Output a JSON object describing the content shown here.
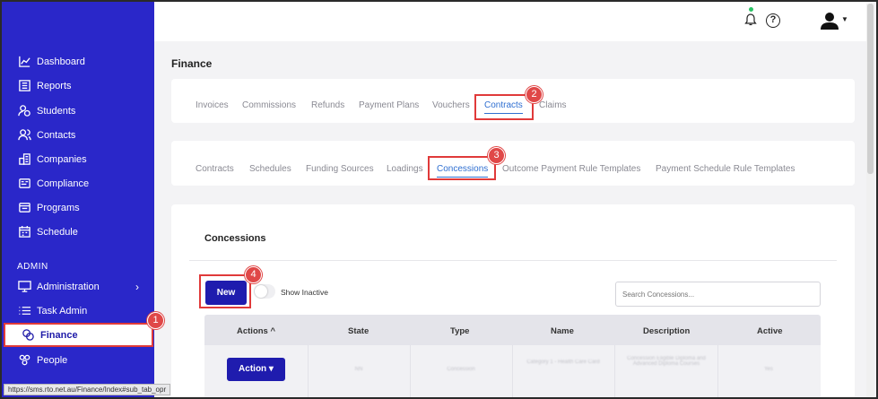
{
  "status_url": "https://sms.rto.net.au/Finance/Index#sub_tab_opr",
  "sidebar": {
    "items": [
      {
        "label": "Dashboard",
        "icon": "chart-line-icon"
      },
      {
        "label": "Reports",
        "icon": "report-icon"
      },
      {
        "label": "Students",
        "icon": "students-icon"
      },
      {
        "label": "Contacts",
        "icon": "contacts-icon"
      },
      {
        "label": "Companies",
        "icon": "companies-icon"
      },
      {
        "label": "Compliance",
        "icon": "compliance-icon"
      },
      {
        "label": "Programs",
        "icon": "programs-icon"
      },
      {
        "label": "Schedule",
        "icon": "calendar-icon"
      }
    ],
    "section_label": "ADMIN",
    "admin_items": [
      {
        "label": "Administration",
        "icon": "monitor-icon",
        "chevron": "›"
      },
      {
        "label": "Task Admin",
        "icon": "list-icon"
      },
      {
        "label": "Finance",
        "icon": "finance-icon",
        "active": true,
        "badge": "1"
      },
      {
        "label": "People",
        "icon": "people-icon"
      }
    ]
  },
  "header": {
    "help_label": "?"
  },
  "page": {
    "title": "Finance",
    "main_tabs": [
      "Invoices",
      "Commissions",
      "Refunds",
      "Payment Plans",
      "Vouchers",
      "Contracts",
      "Claims"
    ],
    "main_tab_badge": "2",
    "sub_tabs": [
      "Contracts",
      "Schedules",
      "Funding Sources",
      "Loadings",
      "Concessions",
      "Outcome Payment Rule Templates",
      "Payment Schedule Rule Templates"
    ],
    "sub_tab_badge": "3",
    "section_title": "Concessions",
    "new_button": "New",
    "new_badge": "4",
    "toggle_label": "Show Inactive",
    "search_placeholder": "Search Concessions...",
    "table": {
      "headers": [
        "Actions ^",
        "State",
        "Type",
        "Name",
        "Description",
        "Active"
      ],
      "row": {
        "action_button": "Action ▾",
        "state": "NN",
        "type": "Concession",
        "name": "Category 1 - Health Care Card",
        "description": "Concession Eligible Diploma and Advanced Diploma Courses",
        "active": "Yes"
      }
    }
  }
}
